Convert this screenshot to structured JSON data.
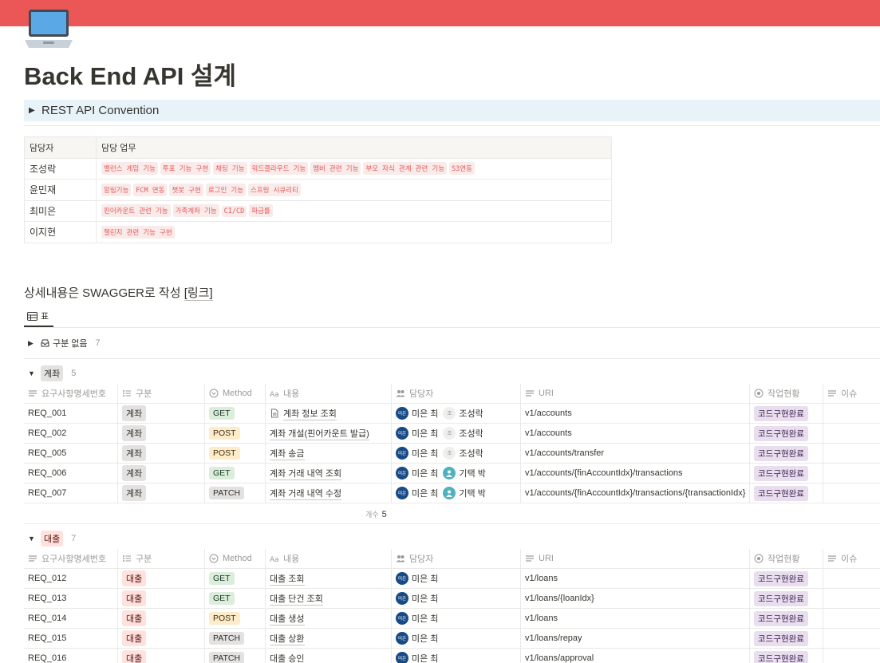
{
  "page": {
    "icon": "laptop-icon",
    "title": "Back End API 설계",
    "cover_color": "#eb5757"
  },
  "toggle": {
    "label": "REST API Convention"
  },
  "owners": {
    "headers": [
      "담당자",
      "담당 업무"
    ],
    "rows": [
      {
        "name": "조성락",
        "tasks": [
          "밸런스 게임 기능",
          "투표 기능 구현",
          "채팅 기능",
          "워드클라우드 기능",
          "멤버 관련 기능",
          "부모 자식 관계 관련 기능",
          "S3연동"
        ]
      },
      {
        "name": "윤민재",
        "tasks": [
          "알림기능",
          "FCM 연동",
          "챗봇 구현",
          "로그인 기능",
          "스프링 시큐리티"
        ]
      },
      {
        "name": "최미은",
        "tasks": [
          "핀어카운트 관련 기능",
          "가족계좌 기능",
          "CI/CD",
          "파급률"
        ]
      },
      {
        "name": "이지현",
        "tasks": [
          "챌린지 관련 기능 구현"
        ]
      }
    ]
  },
  "heading": {
    "text": "상세내용은 SWAGGER로 작성 ",
    "link": "[링크]"
  },
  "view_tab": {
    "label": "표"
  },
  "columns": [
    "요구사항명세번호",
    "구분",
    "Method",
    "내용",
    "담당자",
    "URI",
    "작업현황",
    "이슈"
  ],
  "groups": {
    "none": {
      "label": "구분 없음",
      "count": "7"
    },
    "account": {
      "label": "계좌",
      "count": "5",
      "rows": [
        {
          "id": "REQ_001",
          "cat": "계좌",
          "method": "GET",
          "content": "계좌 정보 조회",
          "p1": "미은 최",
          "p2": "조성락",
          "p2type": "letter",
          "uri": "v1/accounts",
          "status": "코드구현완료"
        },
        {
          "id": "REQ_002",
          "cat": "계좌",
          "method": "POST",
          "content": "계좌 개설(핀어카운트 발급)",
          "p1": "미은 최",
          "p2": "조성락",
          "p2type": "letter",
          "uri": "v1/accounts",
          "status": "코드구현완료"
        },
        {
          "id": "REQ_005",
          "cat": "계좌",
          "method": "POST",
          "content": "계좌 송금",
          "p1": "미은 최",
          "p2": "조성락",
          "p2type": "letter",
          "uri": "v1/accounts/transfer",
          "status": "코드구현완료"
        },
        {
          "id": "REQ_006",
          "cat": "계좌",
          "method": "GET",
          "content": "계좌 거래 내역 조회",
          "p1": "미은 최",
          "p2": "기택 박",
          "p2type": "photo",
          "uri": "v1/accounts/{finAccountIdx}/transactions",
          "status": "코드구현완료"
        },
        {
          "id": "REQ_007",
          "cat": "계좌",
          "method": "PATCH",
          "content": "계좌 거래 내역 수정",
          "p1": "미은 최",
          "p2": "기택 박",
          "p2type": "photo",
          "uri": "v1/accounts/{finAccountIdx}/transactions/{transactionIdx}",
          "status": "코드구현완료"
        }
      ],
      "count_label": "개수",
      "count_value": "5"
    },
    "loan": {
      "label": "대출",
      "count": "7",
      "rows": [
        {
          "id": "REQ_012",
          "cat": "대출",
          "method": "GET",
          "content": "대출 조회",
          "p1": "미은 최",
          "uri": "v1/loans",
          "status": "코드구현완료"
        },
        {
          "id": "REQ_013",
          "cat": "대출",
          "method": "GET",
          "content": "대출 단건 조회",
          "p1": "미은 최",
          "uri": "v1/loans/{loanIdx}",
          "status": "코드구현완료"
        },
        {
          "id": "REQ_014",
          "cat": "대출",
          "method": "POST",
          "content": "대출 생성",
          "p1": "미은 최",
          "uri": "v1/loans",
          "status": "코드구현완료"
        },
        {
          "id": "REQ_015",
          "cat": "대출",
          "method": "PATCH",
          "content": "대출 상환",
          "p1": "미은 최",
          "uri": "v1/loans/repay",
          "status": "코드구현완료"
        },
        {
          "id": "REQ_016",
          "cat": "대출",
          "method": "PATCH",
          "content": "대출 승인",
          "p1": "미은 최",
          "uri": "v1/loans/approval",
          "status": "코드구현완료"
        }
      ]
    }
  },
  "avatar_text": "미은",
  "letter_avatar": "조"
}
